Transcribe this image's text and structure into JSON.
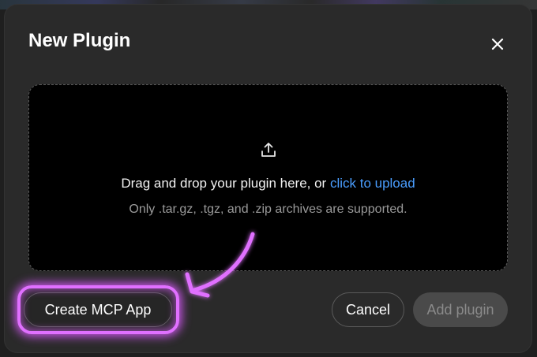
{
  "modal": {
    "title": "New Plugin",
    "close_icon": "close-icon"
  },
  "dropzone": {
    "icon": "upload-icon",
    "text_prefix": "Drag and drop your plugin here, or ",
    "upload_link": "click to upload",
    "supported_formats": "Only .tar.gz, .tgz, and .zip archives are supported."
  },
  "footer": {
    "create_mcp_label": "Create MCP App",
    "cancel_label": "Cancel",
    "add_plugin_label": "Add plugin"
  },
  "annotation": {
    "highlight_color": "#e070ff",
    "target": "Create MCP App"
  },
  "colors": {
    "link": "#4a9eff",
    "modal_bg": "#2a2a2a",
    "dropzone_bg": "#000000",
    "disabled_button_bg": "#4a4a4a"
  }
}
